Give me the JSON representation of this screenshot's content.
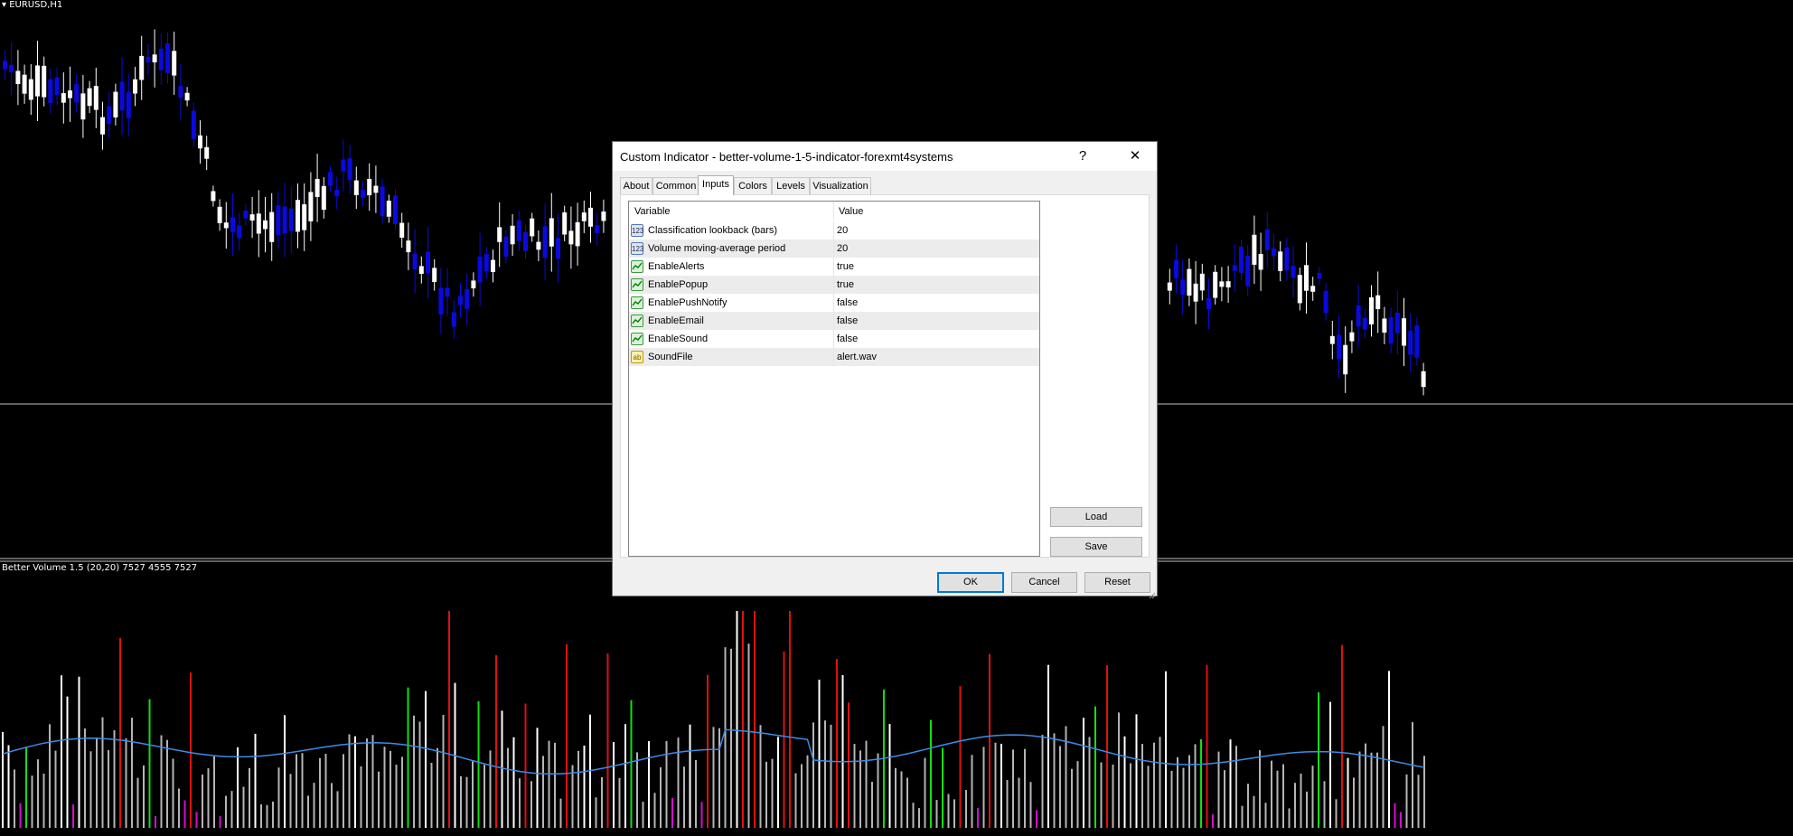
{
  "chart": {
    "symbol_label": "EURUSD,H1",
    "indicator_label": "Better Volume 1.5 (20,20) 7527 4555 7527",
    "colors": {
      "background": "#000000",
      "bull_candle": "#0a0adf",
      "bear_candle": "#ffffff",
      "volume_normal": "#b5b5b5",
      "volume_climax": "#e01010",
      "volume_churn": "#10e010",
      "volume_low": "#d010d0",
      "volume_white": "#ffffff",
      "ma_line": "#3d8be6"
    }
  },
  "dialog": {
    "title": "Custom Indicator - better-volume-1-5-indicator-forexmt4systems",
    "help_label": "?",
    "close_label": "✕",
    "tabs": [
      {
        "label": "About"
      },
      {
        "label": "Common"
      },
      {
        "label": "Inputs"
      },
      {
        "label": "Colors"
      },
      {
        "label": "Levels"
      },
      {
        "label": "Visualization"
      }
    ],
    "active_tab": "Inputs",
    "grid": {
      "headers": {
        "variable": "Variable",
        "value": "Value"
      },
      "rows": [
        {
          "icon": "numeric-icon",
          "icon_text": "123",
          "name": "Classification lookback (bars)",
          "value": "20"
        },
        {
          "icon": "numeric-icon",
          "icon_text": "123",
          "name": "Volume moving-average period",
          "value": "20"
        },
        {
          "icon": "bool-icon",
          "icon_text": "",
          "name": "EnableAlerts",
          "value": "true"
        },
        {
          "icon": "bool-icon",
          "icon_text": "",
          "name": "EnablePopup",
          "value": "true"
        },
        {
          "icon": "bool-icon",
          "icon_text": "",
          "name": "EnablePushNotify",
          "value": "false"
        },
        {
          "icon": "bool-icon",
          "icon_text": "",
          "name": "EnableEmail",
          "value": "false"
        },
        {
          "icon": "bool-icon",
          "icon_text": "",
          "name": "EnableSound",
          "value": "false"
        },
        {
          "icon": "string-icon",
          "icon_text": "ab",
          "name": "SoundFile",
          "value": "alert.wav"
        }
      ]
    },
    "side_buttons": {
      "load": "Load",
      "save": "Save"
    },
    "buttons": {
      "ok": "OK",
      "cancel": "Cancel",
      "reset": "Reset"
    }
  }
}
